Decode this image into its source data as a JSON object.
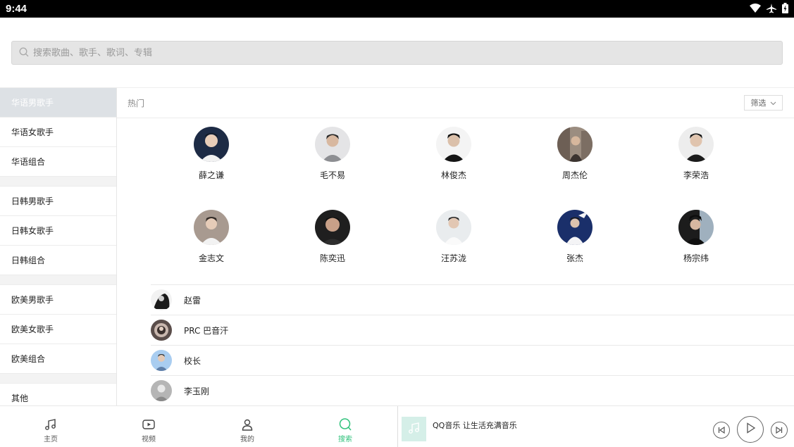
{
  "status": {
    "time": "9:44"
  },
  "search": {
    "placeholder": "搜索歌曲、歌手、歌词、专辑"
  },
  "sidebar": {
    "items": [
      {
        "label": "华语男歌手",
        "active": true
      },
      {
        "label": "华语女歌手"
      },
      {
        "label": "华语组合"
      },
      {
        "label": "日韩男歌手"
      },
      {
        "label": "日韩女歌手"
      },
      {
        "label": "日韩组合"
      },
      {
        "label": "欧美男歌手"
      },
      {
        "label": "欧美女歌手"
      },
      {
        "label": "欧美组合"
      },
      {
        "label": "其他"
      }
    ]
  },
  "main": {
    "section_label": "热门",
    "filter_label": "筛选",
    "hot_artists": [
      {
        "name": "薛之谦"
      },
      {
        "name": "毛不易"
      },
      {
        "name": "林俊杰"
      },
      {
        "name": "周杰伦"
      },
      {
        "name": "李荣浩"
      },
      {
        "name": "金志文"
      },
      {
        "name": "陈奕迅"
      },
      {
        "name": "汪苏泷"
      },
      {
        "name": "张杰"
      },
      {
        "name": "杨宗纬"
      }
    ],
    "artist_list": [
      {
        "name": "赵雷"
      },
      {
        "name": "PRC 巴音汗"
      },
      {
        "name": "校长"
      },
      {
        "name": "李玉刚"
      }
    ]
  },
  "bottom_nav": {
    "tabs": [
      {
        "label": "主页",
        "icon": "music-note-icon"
      },
      {
        "label": "视频",
        "icon": "video-icon"
      },
      {
        "label": "我的",
        "icon": "profile-icon"
      },
      {
        "label": "搜索",
        "icon": "search-icon",
        "active": true
      }
    ]
  },
  "player": {
    "title": "QQ音乐 让生活充满音乐"
  },
  "colors": {
    "accent": "#31c27c",
    "sidebar_active": "#dde1e5",
    "search_bg": "#e5e5e5"
  }
}
